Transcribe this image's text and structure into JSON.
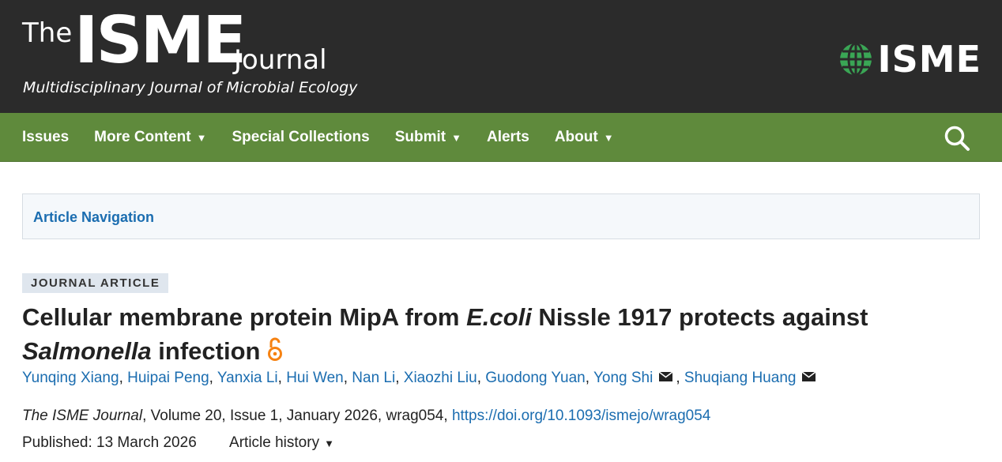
{
  "masthead": {
    "logo_the": "The",
    "logo_isme": "ISME",
    "logo_journal": "Journal",
    "tagline": "Multidisciplinary Journal of Microbial Ecology",
    "society_name": "ISME",
    "society_icon": "globe-icon",
    "bg_color": "#2b2b2b"
  },
  "nav": {
    "color": "#5f8a3c",
    "items": [
      {
        "label": "Issues"
      },
      {
        "label": "More Content",
        "caret": "▼"
      },
      {
        "label": "Special Collections"
      },
      {
        "label": "Submit",
        "caret": "▼"
      },
      {
        "label": "Alerts"
      },
      {
        "label": "About",
        "caret": "▼"
      }
    ],
    "search_icon": "search-icon"
  },
  "article_nav": {
    "label": "Article Navigation"
  },
  "article": {
    "type_badge": "JOURNAL ARTICLE",
    "title_part1": "Cellular membrane protein MipA from ",
    "title_italic1": "E.coli",
    "title_part2": " Nissle 1917 protects against ",
    "title_italic2": "Salmonella",
    "title_part3": " infection",
    "open_access_icon": "open-access-icon",
    "authors": [
      {
        "name": "Yunqing Xiang"
      },
      {
        "name": "Huipai Peng"
      },
      {
        "name": "Yanxia Li"
      },
      {
        "name": "Hui Wen"
      },
      {
        "name": "Nan Li"
      },
      {
        "name": "Xiaozhi Liu"
      },
      {
        "name": "Guodong Yuan"
      },
      {
        "name": "Yong Shi",
        "corresponding": true
      },
      {
        "name": "Shuqiang Huang",
        "corresponding": true
      }
    ],
    "citation_journal": "The ISME Journal",
    "citation_details": ", Volume 20, Issue 1, January 2026, wrag054, ",
    "doi": "https://doi.org/10.1093/ismejo/wrag054",
    "published_label": "Published:",
    "published_date": "13 March 2026",
    "history_label": "Article history",
    "history_caret": "▼"
  },
  "colors": {
    "link": "#1b6db0",
    "badge_bg": "#dfe6ee"
  }
}
